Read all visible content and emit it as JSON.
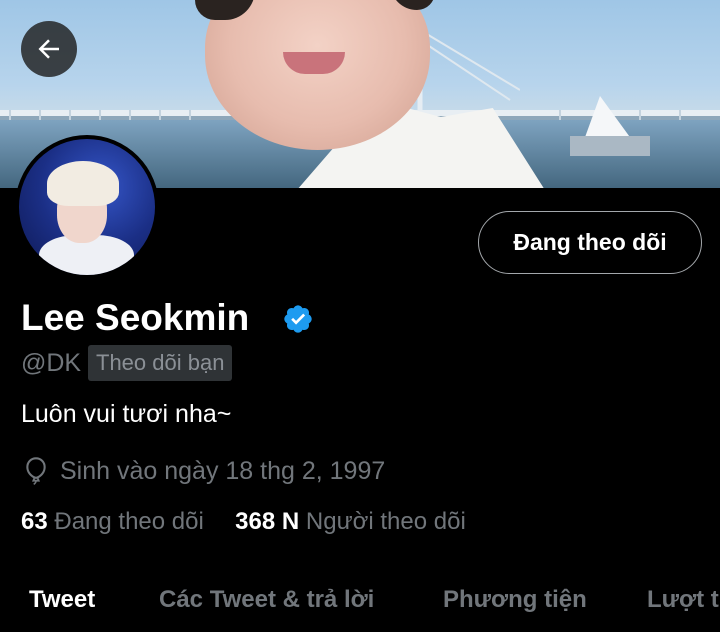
{
  "header": {
    "back_icon": "arrow-left-icon"
  },
  "profile": {
    "follow_button_label": "Đang theo dõi",
    "display_name": "Lee Seokmin",
    "verified": true,
    "verified_color": "#1d9bf0",
    "handle": "@DK",
    "follows_you_label": "Theo dõi bạn",
    "bio": "Luôn vui tươi nha~",
    "birthday": "Sinh vào ngày 18 thg 2, 1997",
    "birthday_icon": "balloon-icon",
    "following_count": "63",
    "following_label": "Đang theo dõi",
    "followers_count": "368 N",
    "followers_label": "Người theo dõi"
  },
  "tabs": [
    {
      "label": "Tweet",
      "active": true
    },
    {
      "label": "Các Tweet & trả lời",
      "active": false
    },
    {
      "label": "Phương tiện",
      "active": false
    },
    {
      "label": "Lượt thích",
      "active": false
    }
  ]
}
